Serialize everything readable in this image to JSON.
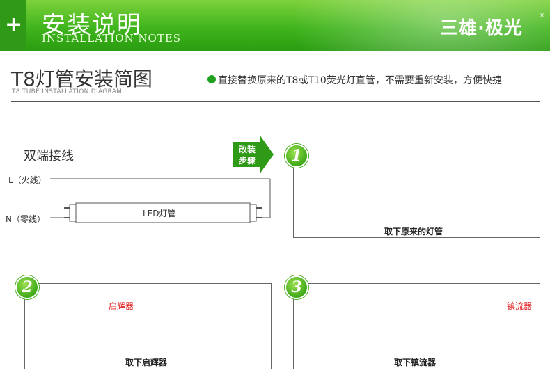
{
  "banner": {
    "icon": "plus-icon",
    "title": "安装说明",
    "subtitle": "INSTALLATION NOTES",
    "brand": "三雄·极光",
    "brand_mark": "®"
  },
  "section": {
    "title": "T8灯管安装简图",
    "subtitle": "T8 TUBE INSTALLATION DIAGRAM",
    "note": "直接替换原来的T8或T10荧光灯直管，不需要重新安装，方便快捷"
  },
  "wiring": {
    "title": "双端接线",
    "live_label": "L（火线）",
    "neutral_label": "N（零线）",
    "tube_label": "LED灯管"
  },
  "step_arrow": {
    "line1": "改装",
    "line2": "步骤"
  },
  "steps": [
    {
      "number": "1",
      "caption": "取下原来的灯管"
    },
    {
      "number": "2",
      "caption": "取下启辉器",
      "part_label": "启辉器"
    },
    {
      "number": "3",
      "caption": "取下镇流器",
      "part_label": "镇流器"
    }
  ],
  "colors": {
    "brand_green": "#3fb41c",
    "accent_red": "#e02020",
    "line": "#555555"
  }
}
